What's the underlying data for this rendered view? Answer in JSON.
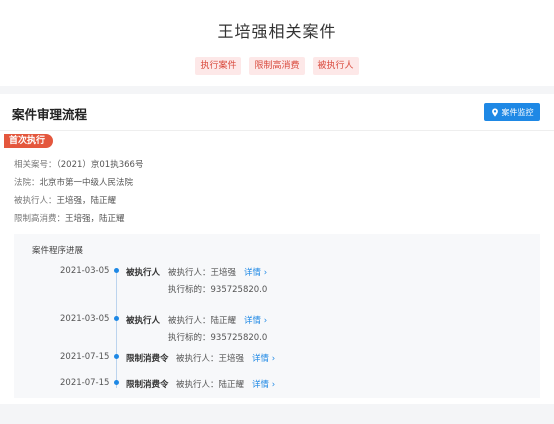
{
  "header": {
    "title": "王培强相关案件",
    "tags": [
      "执行案件",
      "限制高消费",
      "被执行人"
    ]
  },
  "card": {
    "title": "案件审理流程",
    "monitor_label": "案件监控",
    "badge": "首次执行",
    "info": [
      {
        "label": "相关案号：",
        "value": "（2021）京01执366号"
      },
      {
        "label": "法院：",
        "value": "北京市第一中级人民法院"
      },
      {
        "label": "被执行人：",
        "value": "王培强，陆正耀"
      },
      {
        "label": "限制高消费：",
        "value": "王培强，陆正耀"
      }
    ]
  },
  "timeline": {
    "title": "案件程序进展",
    "events": [
      {
        "date": "2021-03-05",
        "type": "被执行人",
        "party": "被执行人：王培强",
        "detail": "详情 ›",
        "amount": "执行标的：935725820.0"
      },
      {
        "date": "2021-03-05",
        "type": "被执行人",
        "party": "被执行人：陆正耀",
        "detail": "详情 ›",
        "amount": "执行标的：935725820.0"
      },
      {
        "date": "2021-07-15",
        "type": "限制消费令",
        "party": "被执行人：王培强",
        "detail": "详情 ›",
        "amount": ""
      },
      {
        "date": "2021-07-15",
        "type": "限制消费令",
        "party": "被执行人：陆正耀",
        "detail": "详情 ›",
        "amount": ""
      }
    ]
  },
  "colors": {
    "accent": "#1e88e5",
    "badge": "#e4573d",
    "tag_text": "#d94a3d",
    "tag_bg": "#fde8e8"
  }
}
